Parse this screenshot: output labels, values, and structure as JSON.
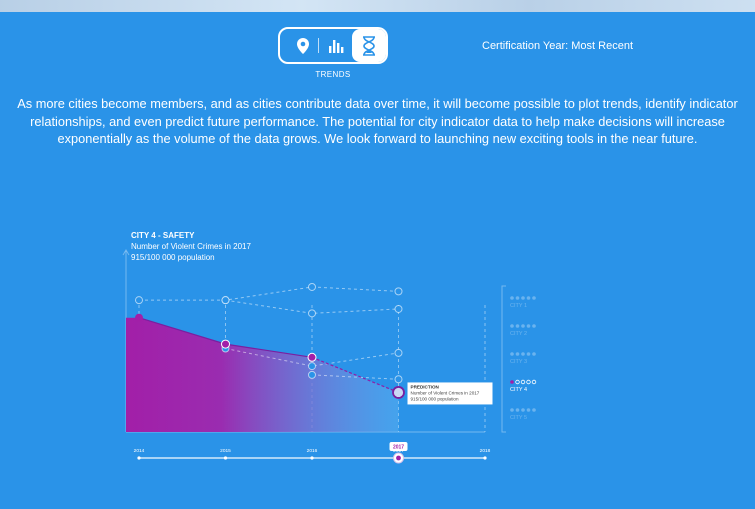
{
  "view_toggle": {
    "options": [
      {
        "icon": "map-pin-icon",
        "label": "Map"
      },
      {
        "icon": "bar-chart-icon",
        "label": "Compare"
      },
      {
        "icon": "hourglass-icon",
        "label": "Trends"
      }
    ],
    "active_label": "TRENDS"
  },
  "certification": "Certification Year: Most Recent",
  "intro_text": "As more cities become members, and as cities contribute data over time, it will become possible to plot trends, identify indicator relationships, and even predict future performance. The potential for city indicator data to help make decisions will increase exponentially as the volume of the data grows. We look forward to launching new exciting tools in the near future.",
  "colors": {
    "background": "#2a93e8",
    "area_start": "#a21fa8",
    "area_end": "#5fb3f2",
    "accent": "#8e1fa8"
  },
  "chart_data": {
    "type": "area",
    "title": "CITY 4 - SAFETY",
    "subtitle": "Number of Violent Crimes in 2017",
    "value_label": "915/100 000 population",
    "x": [
      "2014",
      "2015",
      "2016",
      "2017",
      "2018"
    ],
    "series": [
      {
        "name": "CITY 4",
        "values": [
          1000,
          970,
          955,
          915,
          null
        ],
        "highlight": true
      },
      {
        "name": "CITY 1",
        "values": [
          1020,
          1020,
          1035,
          1030,
          null
        ]
      },
      {
        "name": "CITY 2",
        "values": [
          null,
          1020,
          1005,
          1010,
          null
        ]
      },
      {
        "name": "CITY 3",
        "values": [
          null,
          965,
          945,
          960,
          null
        ]
      },
      {
        "name": "CITY 5",
        "values": [
          null,
          null,
          935,
          930,
          null
        ]
      }
    ],
    "prediction": {
      "title": "PREDICTION",
      "line1": "Number of Violent Crimes in 2017",
      "line2": "915/100 000 population"
    },
    "legend": [
      "CITY 1",
      "CITY 2",
      "CITY 3",
      "CITY 4",
      "CITY 5"
    ],
    "legend_active": "CITY 4",
    "timeline": {
      "selected": "2017"
    },
    "ylim": [
      870,
      1060
    ]
  }
}
